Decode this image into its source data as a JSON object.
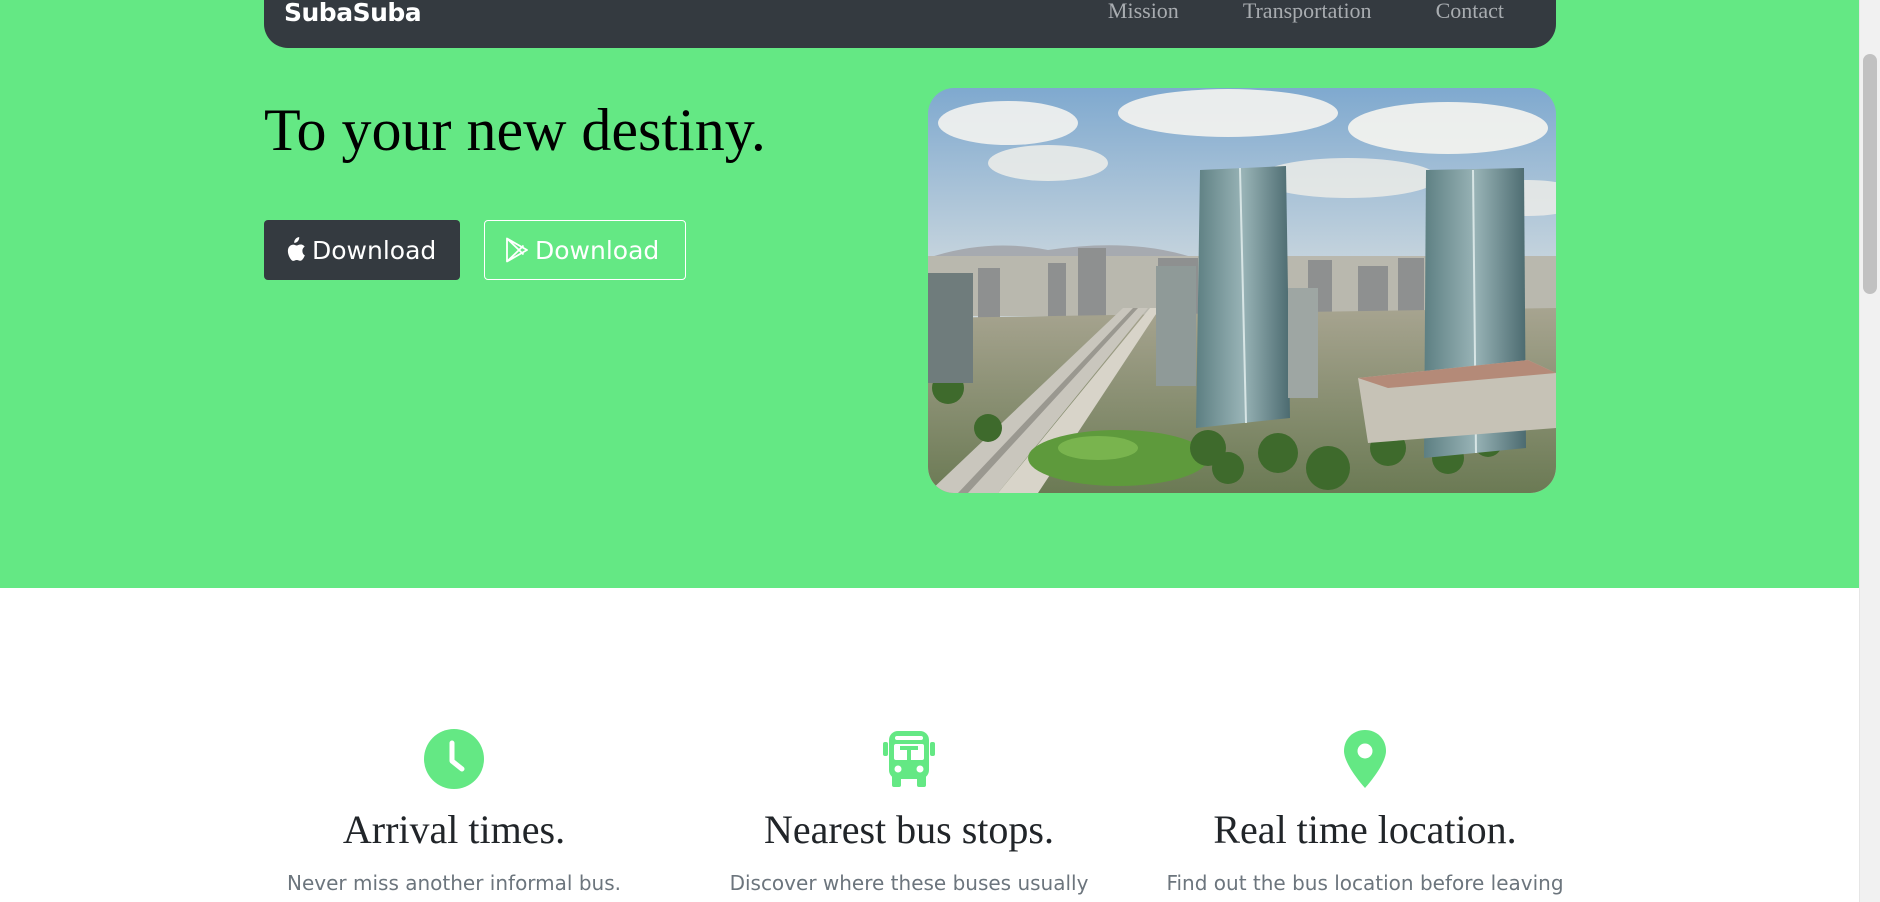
{
  "brand": "SubaSuba",
  "nav": {
    "links": [
      "Mission",
      "Transportation",
      "Contact"
    ]
  },
  "hero": {
    "headline": "To your new destiny.",
    "apple_button_label": "Download",
    "play_button_label": "Download",
    "image_alt": "Aerial view of a city highway with glass skyscrapers"
  },
  "features": [
    {
      "icon": "clock-icon",
      "title": "Arrival times.",
      "description": "Never miss another informal bus."
    },
    {
      "icon": "bus-icon",
      "title": "Nearest bus stops.",
      "description": "Discover where these buses usually"
    },
    {
      "icon": "map-marker-icon",
      "title": "Real time location.",
      "description": "Find out the bus location before leaving"
    }
  ],
  "colors": {
    "hero_background": "#64e884",
    "navbar": "#343a40",
    "accent": "#64e884"
  }
}
